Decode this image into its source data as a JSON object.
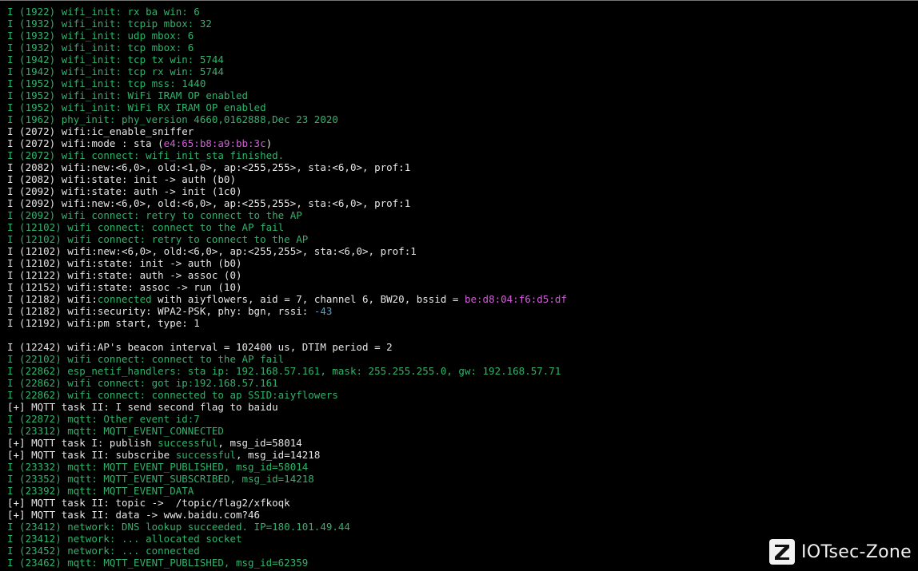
{
  "terminal": {
    "lines": [
      [
        {
          "t": "I (1922) wifi_init: rx ba win: 6",
          "c": "g"
        }
      ],
      [
        {
          "t": "I (1932) wifi_init: tcpip mbox: 32",
          "c": "g"
        }
      ],
      [
        {
          "t": "I (1932) wifi_init: udp mbox: 6",
          "c": "g"
        }
      ],
      [
        {
          "t": "I (1932) wifi_init: tcp mbox: 6",
          "c": "g"
        }
      ],
      [
        {
          "t": "I (1942) wifi_init: tcp tx win: 5744",
          "c": "g"
        }
      ],
      [
        {
          "t": "I (1942) wifi_init: tcp rx win: 5744",
          "c": "g"
        }
      ],
      [
        {
          "t": "I (1952) wifi_init: tcp mss: 1440",
          "c": "g"
        }
      ],
      [
        {
          "t": "I (1952) wifi_init: WiFi IRAM OP enabled",
          "c": "g"
        }
      ],
      [
        {
          "t": "I (1952) wifi_init: WiFi RX IRAM OP enabled",
          "c": "g"
        }
      ],
      [
        {
          "t": "I (1962) phy_init: phy_version 4660,0162888,Dec 23 2020",
          "c": "g"
        }
      ],
      [
        {
          "t": "I (2072) wifi:ic_enable_sniffer",
          "c": "w"
        }
      ],
      [
        {
          "t": "I (2072) wifi:mode : sta (",
          "c": "w"
        },
        {
          "t": "e4:65:b8:a9:bb:3c",
          "c": "m"
        },
        {
          "t": ")",
          "c": "w"
        }
      ],
      [
        {
          "t": "I (2072) wifi connect: wifi_init_sta finished.",
          "c": "g"
        }
      ],
      [
        {
          "t": "I (2082) wifi:new:<6,0>, old:<1,0>, ap:<255,255>, sta:<6,0>, prof:1",
          "c": "w"
        }
      ],
      [
        {
          "t": "I (2082) wifi:state: init -> auth (b0)",
          "c": "w"
        }
      ],
      [
        {
          "t": "I (2092) wifi:state: auth -> init (1c0)",
          "c": "w"
        }
      ],
      [
        {
          "t": "I (2092) wifi:new:<6,0>, old:<6,0>, ap:<255,255>, sta:<6,0>, prof:1",
          "c": "w"
        }
      ],
      [
        {
          "t": "I (2092) wifi connect: retry to connect to the AP",
          "c": "g"
        }
      ],
      [
        {
          "t": "I (12102) wifi connect: connect to the AP fail",
          "c": "g"
        }
      ],
      [
        {
          "t": "I (12102) wifi connect: retry to connect to the AP",
          "c": "g"
        }
      ],
      [
        {
          "t": "I (12102) wifi:new:<6,0>, old:<6,0>, ap:<255,255>, sta:<6,0>, prof:1",
          "c": "w"
        }
      ],
      [
        {
          "t": "I (12102) wifi:state: init -> auth (b0)",
          "c": "w"
        }
      ],
      [
        {
          "t": "I (12122) wifi:state: auth -> assoc (0)",
          "c": "w"
        }
      ],
      [
        {
          "t": "I (12152) wifi:state: assoc -> run (10)",
          "c": "w"
        }
      ],
      [
        {
          "t": "I (12182) wifi:",
          "c": "w"
        },
        {
          "t": "connected",
          "c": "g"
        },
        {
          "t": " with aiyflowers, aid = 7, channel 6, BW20, bssid = ",
          "c": "w"
        },
        {
          "t": "be:d8:04:f6:d5:df",
          "c": "m"
        }
      ],
      [
        {
          "t": "I (12182) wifi:security: WPA2-PSK, phy: bgn, rssi: ",
          "c": "w"
        },
        {
          "t": "-43",
          "c": "b"
        }
      ],
      [
        {
          "t": "I (12192) wifi:pm start, type: 1",
          "c": "w"
        }
      ],
      [
        {
          "t": "",
          "c": "w"
        }
      ],
      [
        {
          "t": "I (12242) wifi:AP's beacon interval = 102400 us, DTIM period = 2",
          "c": "w"
        }
      ],
      [
        {
          "t": "I (22102) wifi connect: connect to the AP fail",
          "c": "g"
        }
      ],
      [
        {
          "t": "I (22862) esp_netif_handlers: sta ip: 192.168.57.161, mask: 255.255.255.0, gw: 192.168.57.71",
          "c": "g"
        }
      ],
      [
        {
          "t": "I (22862) wifi connect: got ip:192.168.57.161",
          "c": "g"
        }
      ],
      [
        {
          "t": "I (22862) wifi connect: connected to ap SSID:aiyflowers",
          "c": "g"
        }
      ],
      [
        {
          "t": "[+] MQTT task II: I send second flag to baidu",
          "c": "w"
        }
      ],
      [
        {
          "t": "I (22872) mqtt: Other event id:7",
          "c": "g"
        }
      ],
      [
        {
          "t": "I (23312) mqtt: MQTT_EVENT_CONNECTED",
          "c": "g"
        }
      ],
      [
        {
          "t": "[+] MQTT task I: publish ",
          "c": "w"
        },
        {
          "t": "successful",
          "c": "g"
        },
        {
          "t": ", msg_id=58014",
          "c": "w"
        }
      ],
      [
        {
          "t": "[+] MQTT task II: subscribe ",
          "c": "w"
        },
        {
          "t": "successful",
          "c": "g"
        },
        {
          "t": ", msg_id=14218",
          "c": "w"
        }
      ],
      [
        {
          "t": "I (23332) mqtt: MQTT_EVENT_PUBLISHED, msg_id=58014",
          "c": "g"
        }
      ],
      [
        {
          "t": "I (23352) mqtt: MQTT_EVENT_SUBSCRIBED, msg_id=14218",
          "c": "g"
        }
      ],
      [
        {
          "t": "I (23392) mqtt: MQTT_EVENT_DATA",
          "c": "g"
        }
      ],
      [
        {
          "t": "[+] MQTT task II: topic ->  /topic/flag2/xfkoqk",
          "c": "w"
        }
      ],
      [
        {
          "t": "[+] MQTT task II: data -> www.baidu.com?46",
          "c": "w"
        }
      ],
      [
        {
          "t": "I (23412) network: DNS lookup succeeded. IP=180.101.49.44",
          "c": "g"
        }
      ],
      [
        {
          "t": "I (23412) network: ... allocated socket",
          "c": "g"
        }
      ],
      [
        {
          "t": "I (23452) network: ... connected",
          "c": "g"
        }
      ],
      [
        {
          "t": "I (23462) mqtt: MQTT_EVENT_PUBLISHED, msg_id=62359",
          "c": "g"
        }
      ]
    ]
  },
  "watermark": {
    "text": "IOTsec-Zone",
    "icon": "z-logo-icon"
  }
}
